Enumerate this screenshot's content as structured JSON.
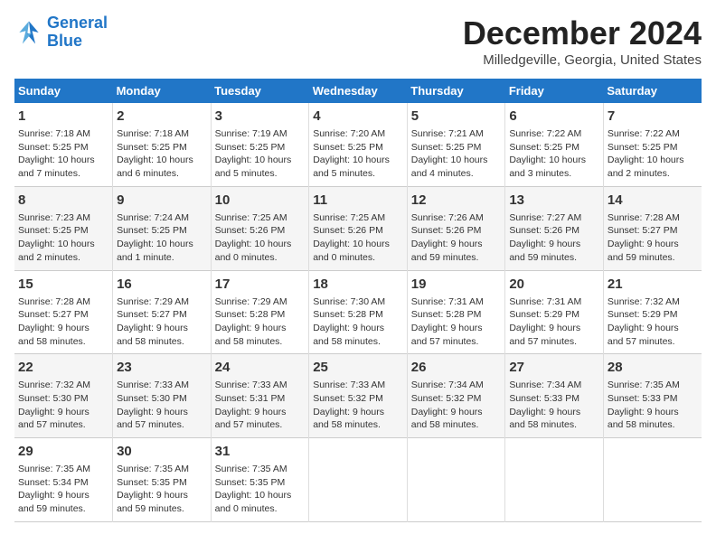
{
  "logo": {
    "line1": "General",
    "line2": "Blue"
  },
  "title": "December 2024",
  "location": "Milledgeville, Georgia, United States",
  "days_of_week": [
    "Sunday",
    "Monday",
    "Tuesday",
    "Wednesday",
    "Thursday",
    "Friday",
    "Saturday"
  ],
  "weeks": [
    [
      {
        "day": "1",
        "info": "Sunrise: 7:18 AM\nSunset: 5:25 PM\nDaylight: 10 hours\nand 7 minutes."
      },
      {
        "day": "2",
        "info": "Sunrise: 7:18 AM\nSunset: 5:25 PM\nDaylight: 10 hours\nand 6 minutes."
      },
      {
        "day": "3",
        "info": "Sunrise: 7:19 AM\nSunset: 5:25 PM\nDaylight: 10 hours\nand 5 minutes."
      },
      {
        "day": "4",
        "info": "Sunrise: 7:20 AM\nSunset: 5:25 PM\nDaylight: 10 hours\nand 5 minutes."
      },
      {
        "day": "5",
        "info": "Sunrise: 7:21 AM\nSunset: 5:25 PM\nDaylight: 10 hours\nand 4 minutes."
      },
      {
        "day": "6",
        "info": "Sunrise: 7:22 AM\nSunset: 5:25 PM\nDaylight: 10 hours\nand 3 minutes."
      },
      {
        "day": "7",
        "info": "Sunrise: 7:22 AM\nSunset: 5:25 PM\nDaylight: 10 hours\nand 2 minutes."
      }
    ],
    [
      {
        "day": "8",
        "info": "Sunrise: 7:23 AM\nSunset: 5:25 PM\nDaylight: 10 hours\nand 2 minutes."
      },
      {
        "day": "9",
        "info": "Sunrise: 7:24 AM\nSunset: 5:25 PM\nDaylight: 10 hours\nand 1 minute."
      },
      {
        "day": "10",
        "info": "Sunrise: 7:25 AM\nSunset: 5:26 PM\nDaylight: 10 hours\nand 0 minutes."
      },
      {
        "day": "11",
        "info": "Sunrise: 7:25 AM\nSunset: 5:26 PM\nDaylight: 10 hours\nand 0 minutes."
      },
      {
        "day": "12",
        "info": "Sunrise: 7:26 AM\nSunset: 5:26 PM\nDaylight: 9 hours\nand 59 minutes."
      },
      {
        "day": "13",
        "info": "Sunrise: 7:27 AM\nSunset: 5:26 PM\nDaylight: 9 hours\nand 59 minutes."
      },
      {
        "day": "14",
        "info": "Sunrise: 7:28 AM\nSunset: 5:27 PM\nDaylight: 9 hours\nand 59 minutes."
      }
    ],
    [
      {
        "day": "15",
        "info": "Sunrise: 7:28 AM\nSunset: 5:27 PM\nDaylight: 9 hours\nand 58 minutes."
      },
      {
        "day": "16",
        "info": "Sunrise: 7:29 AM\nSunset: 5:27 PM\nDaylight: 9 hours\nand 58 minutes."
      },
      {
        "day": "17",
        "info": "Sunrise: 7:29 AM\nSunset: 5:28 PM\nDaylight: 9 hours\nand 58 minutes."
      },
      {
        "day": "18",
        "info": "Sunrise: 7:30 AM\nSunset: 5:28 PM\nDaylight: 9 hours\nand 58 minutes."
      },
      {
        "day": "19",
        "info": "Sunrise: 7:31 AM\nSunset: 5:28 PM\nDaylight: 9 hours\nand 57 minutes."
      },
      {
        "day": "20",
        "info": "Sunrise: 7:31 AM\nSunset: 5:29 PM\nDaylight: 9 hours\nand 57 minutes."
      },
      {
        "day": "21",
        "info": "Sunrise: 7:32 AM\nSunset: 5:29 PM\nDaylight: 9 hours\nand 57 minutes."
      }
    ],
    [
      {
        "day": "22",
        "info": "Sunrise: 7:32 AM\nSunset: 5:30 PM\nDaylight: 9 hours\nand 57 minutes."
      },
      {
        "day": "23",
        "info": "Sunrise: 7:33 AM\nSunset: 5:30 PM\nDaylight: 9 hours\nand 57 minutes."
      },
      {
        "day": "24",
        "info": "Sunrise: 7:33 AM\nSunset: 5:31 PM\nDaylight: 9 hours\nand 57 minutes."
      },
      {
        "day": "25",
        "info": "Sunrise: 7:33 AM\nSunset: 5:32 PM\nDaylight: 9 hours\nand 58 minutes."
      },
      {
        "day": "26",
        "info": "Sunrise: 7:34 AM\nSunset: 5:32 PM\nDaylight: 9 hours\nand 58 minutes."
      },
      {
        "day": "27",
        "info": "Sunrise: 7:34 AM\nSunset: 5:33 PM\nDaylight: 9 hours\nand 58 minutes."
      },
      {
        "day": "28",
        "info": "Sunrise: 7:35 AM\nSunset: 5:33 PM\nDaylight: 9 hours\nand 58 minutes."
      }
    ],
    [
      {
        "day": "29",
        "info": "Sunrise: 7:35 AM\nSunset: 5:34 PM\nDaylight: 9 hours\nand 59 minutes."
      },
      {
        "day": "30",
        "info": "Sunrise: 7:35 AM\nSunset: 5:35 PM\nDaylight: 9 hours\nand 59 minutes."
      },
      {
        "day": "31",
        "info": "Sunrise: 7:35 AM\nSunset: 5:35 PM\nDaylight: 10 hours\nand 0 minutes."
      },
      {
        "day": "",
        "info": ""
      },
      {
        "day": "",
        "info": ""
      },
      {
        "day": "",
        "info": ""
      },
      {
        "day": "",
        "info": ""
      }
    ]
  ]
}
